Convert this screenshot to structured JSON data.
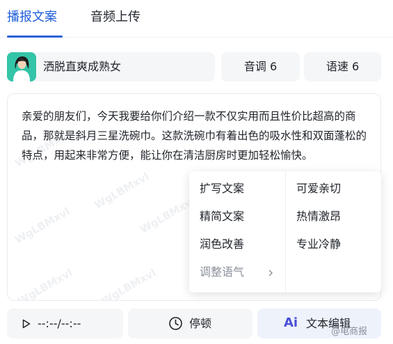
{
  "tabs": [
    {
      "label": "播报文案",
      "active": true
    },
    {
      "label": "音频上传",
      "active": false
    }
  ],
  "voice": {
    "name": "洒脱直爽成熟女"
  },
  "tone": {
    "label": "音调 6"
  },
  "speed": {
    "label": "语速 6"
  },
  "script": {
    "text": "亲爱的朋友们，今天我要给你们介绍一款不仅实用而且性价比超高的商品，那就是斜月三星洗碗巾。这款洗碗巾有着出色的吸水性和双面蓬松的特点，用起来非常方便，能让你在清洁厨房时更加轻松愉快。"
  },
  "watermark": "WgLBMxvl",
  "menu": {
    "left": [
      "扩写文案",
      "精简文案",
      "润色改善",
      "调整语气"
    ],
    "right": [
      "可爱亲切",
      "热情激昂",
      "专业冷静"
    ]
  },
  "actions": {
    "time": "--:--/--:--",
    "pause_label": "停顿",
    "ai_label": "Ai",
    "edit_label": "文本编辑"
  },
  "credit": "@电商报",
  "colors": {
    "accent": "#1f5fd8",
    "avatar_bg": "#34c4a8",
    "ai": "#4a4fd6"
  }
}
